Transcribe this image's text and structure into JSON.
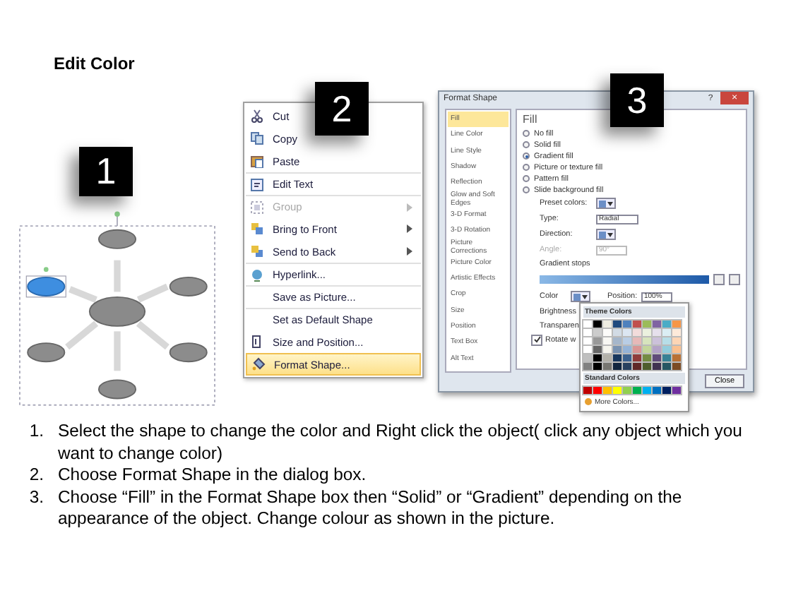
{
  "title": "Edit Color",
  "steps": [
    {
      "badge": "1",
      "diagram": {
        "nodes": [
          {
            "selected": false
          },
          {
            "selected": false
          },
          {
            "selected": false
          },
          {
            "selected": false
          },
          {
            "selected": false
          },
          {
            "selected": true
          }
        ]
      }
    },
    {
      "badge": "2",
      "menu": [
        {
          "label": "Cut",
          "disabled": false,
          "submenu": false,
          "selected": false
        },
        {
          "label": "Copy",
          "disabled": false,
          "submenu": false,
          "selected": false
        },
        {
          "label": "Paste",
          "disabled": false,
          "submenu": false,
          "selected": false
        },
        {
          "label": "Edit Text",
          "disabled": false,
          "submenu": false,
          "selected": false
        },
        {
          "label": "Group",
          "disabled": true,
          "submenu": true,
          "selected": false
        },
        {
          "label": "Bring to Front",
          "disabled": false,
          "submenu": true,
          "selected": false
        },
        {
          "label": "Send to Back",
          "disabled": false,
          "submenu": true,
          "selected": false
        },
        {
          "label": "Hyperlink...",
          "disabled": false,
          "submenu": false,
          "selected": false
        },
        {
          "label": "Save as Picture...",
          "disabled": false,
          "submenu": false,
          "selected": false
        },
        {
          "label": "Set as Default Shape",
          "disabled": false,
          "submenu": false,
          "selected": false
        },
        {
          "label": "Size and Position...",
          "disabled": false,
          "submenu": false,
          "selected": false
        },
        {
          "label": "Format Shape...",
          "disabled": false,
          "submenu": false,
          "selected": true
        }
      ]
    },
    {
      "badge": "3",
      "dialog": {
        "title": "Format Shape",
        "help": "?",
        "close_x": "×",
        "categories": [
          {
            "label": "Fill",
            "selected": true
          },
          {
            "label": "Line Color",
            "selected": false
          },
          {
            "label": "Line Style",
            "selected": false
          },
          {
            "label": "Shadow",
            "selected": false
          },
          {
            "label": "Reflection",
            "selected": false
          },
          {
            "label": "Glow and Soft Edges",
            "selected": false
          },
          {
            "label": "3-D Format",
            "selected": false
          },
          {
            "label": "3-D Rotation",
            "selected": false
          },
          {
            "label": "Picture Corrections",
            "selected": false
          },
          {
            "label": "Picture Color",
            "selected": false
          },
          {
            "label": "Artistic Effects",
            "selected": false
          },
          {
            "label": "Crop",
            "selected": false
          },
          {
            "label": "Size",
            "selected": false
          },
          {
            "label": "Position",
            "selected": false
          },
          {
            "label": "Text Box",
            "selected": false
          },
          {
            "label": "Alt Text",
            "selected": false
          }
        ],
        "heading": "Fill",
        "fill_options": [
          {
            "label": "No fill",
            "selected": false
          },
          {
            "label": "Solid fill",
            "selected": false
          },
          {
            "label": "Gradient fill",
            "selected": true
          },
          {
            "label": "Picture or texture fill",
            "selected": false
          },
          {
            "label": "Pattern fill",
            "selected": false
          },
          {
            "label": "Slide background fill",
            "selected": false
          }
        ],
        "preset_label": "Preset colors:",
        "type_label": "Type:",
        "type_value": "Radial",
        "direction_label": "Direction:",
        "angle_label": "Angle:",
        "angle_value": "90°",
        "stops_label": "Gradient stops",
        "color_label": "Color",
        "position_label": "Position:",
        "position_value": "100%",
        "brightness_label": "Brightness",
        "transparency_label": "Transparen",
        "rotate": {
          "label": "Rotate w",
          "checked": true
        },
        "close": "Close",
        "palette": {
          "theme_title": "Theme Colors",
          "theme_colors": [
            {
              "color": "#ffffff"
            },
            {
              "color": "#000000"
            },
            {
              "color": "#eeece1"
            },
            {
              "color": "#1f497d"
            },
            {
              "color": "#4f81bd"
            },
            {
              "color": "#c0504d"
            },
            {
              "color": "#9bbb59"
            },
            {
              "color": "#8064a2"
            },
            {
              "color": "#4bacc6"
            },
            {
              "color": "#f79646"
            }
          ],
          "standard_title": "Standard Colors",
          "standard_colors": [
            {
              "color": "#c00000"
            },
            {
              "color": "#ff0000"
            },
            {
              "color": "#ffc000"
            },
            {
              "color": "#ffff00"
            },
            {
              "color": "#92d050"
            },
            {
              "color": "#00b050"
            },
            {
              "color": "#00b0f0"
            },
            {
              "color": "#0070c0"
            },
            {
              "color": "#002060"
            },
            {
              "color": "#7030a0"
            }
          ],
          "more": "More Colors..."
        }
      }
    }
  ],
  "instructions": [
    {
      "number": "1.",
      "text": "Select the shape to change the color and Right click the object( click any object which you want to change color)"
    },
    {
      "number": "2.",
      "text": "Choose Format Shape in the dialog box."
    },
    {
      "number": "3.",
      "text": "Choose “Fill” in the Format Shape box then “Solid” or “Gradient” depending on the appearance of the object. Change colour as shown in the picture."
    }
  ]
}
